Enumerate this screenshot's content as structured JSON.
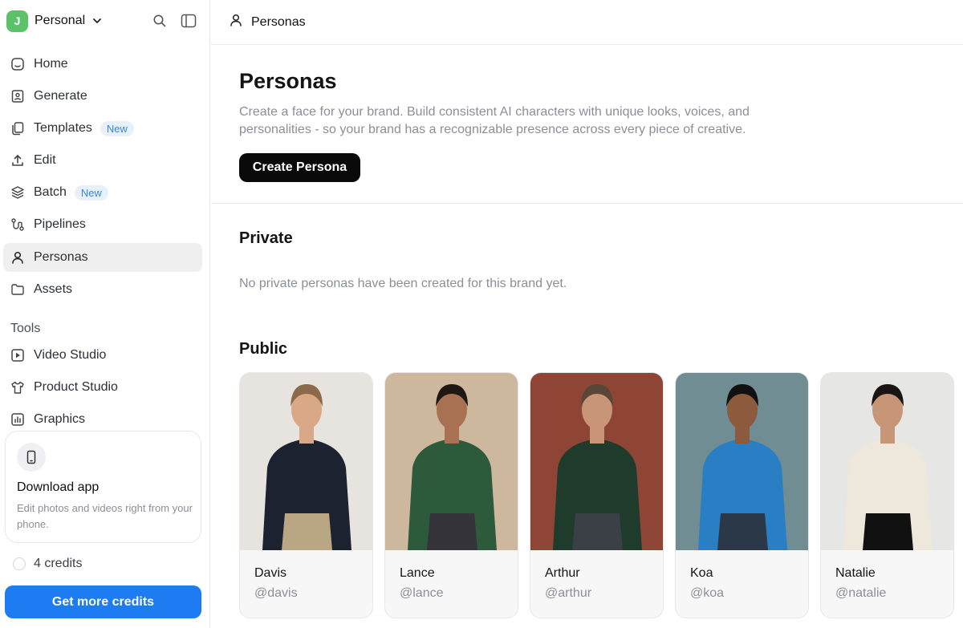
{
  "workspace": {
    "initial": "J",
    "name": "Personal"
  },
  "nav": [
    {
      "label": "Home",
      "icon": "home-icon"
    },
    {
      "label": "Generate",
      "icon": "image-icon"
    },
    {
      "label": "Templates",
      "icon": "copy-icon",
      "badge": "New"
    },
    {
      "label": "Edit",
      "icon": "upload-icon"
    },
    {
      "label": "Batch",
      "icon": "layers-icon",
      "badge": "New"
    },
    {
      "label": "Pipelines",
      "icon": "pipeline-icon"
    },
    {
      "label": "Personas",
      "icon": "user-icon",
      "active": true
    },
    {
      "label": "Assets",
      "icon": "folder-icon"
    }
  ],
  "tools": {
    "label": "Tools",
    "items": [
      {
        "label": "Video Studio",
        "icon": "play-icon"
      },
      {
        "label": "Product Studio",
        "icon": "shirt-icon"
      },
      {
        "label": "Graphics",
        "icon": "chart-icon"
      }
    ]
  },
  "download": {
    "title": "Download app",
    "description": "Edit photos and videos right from your phone."
  },
  "credits": {
    "count": "4 credits",
    "button": "Get more credits"
  },
  "breadcrumb": {
    "label": "Personas"
  },
  "hero": {
    "title": "Personas",
    "description": "Create a face for your brand. Build consistent AI characters with unique looks, voices, and personalities - so your brand has a recognizable presence across every piece of creative.",
    "button": "Create Persona"
  },
  "private": {
    "title": "Private",
    "empty": "No private personas have been created for this brand yet."
  },
  "public": {
    "title": "Public",
    "personas": [
      {
        "name": "Davis",
        "handle": "@davis",
        "bg": "#e7e4df",
        "skin": "#d9a887",
        "hair": "#8a6a48",
        "top": "#1c2230",
        "bottom": "#b9a784"
      },
      {
        "name": "Lance",
        "handle": "@lance",
        "bg": "#cdb89e",
        "skin": "#a87252",
        "hair": "#1e1712",
        "top": "#2d5a3a",
        "bottom": "#34343a"
      },
      {
        "name": "Arthur",
        "handle": "@arthur",
        "bg": "#8e4535",
        "skin": "#c99577",
        "hair": "#5a4636",
        "top": "#1f3b2c",
        "bottom": "#3b3f46"
      },
      {
        "name": "Koa",
        "handle": "@koa",
        "bg": "#6f8d92",
        "skin": "#8c5a3c",
        "hair": "#111111",
        "top": "#2a7fc4",
        "bottom": "#2b3848"
      },
      {
        "name": "Natalie",
        "handle": "@natalie",
        "bg": "#e6e6e4",
        "skin": "#c79676",
        "hair": "#1a1412",
        "top": "#ede7dc",
        "bottom": "#111111"
      }
    ]
  }
}
